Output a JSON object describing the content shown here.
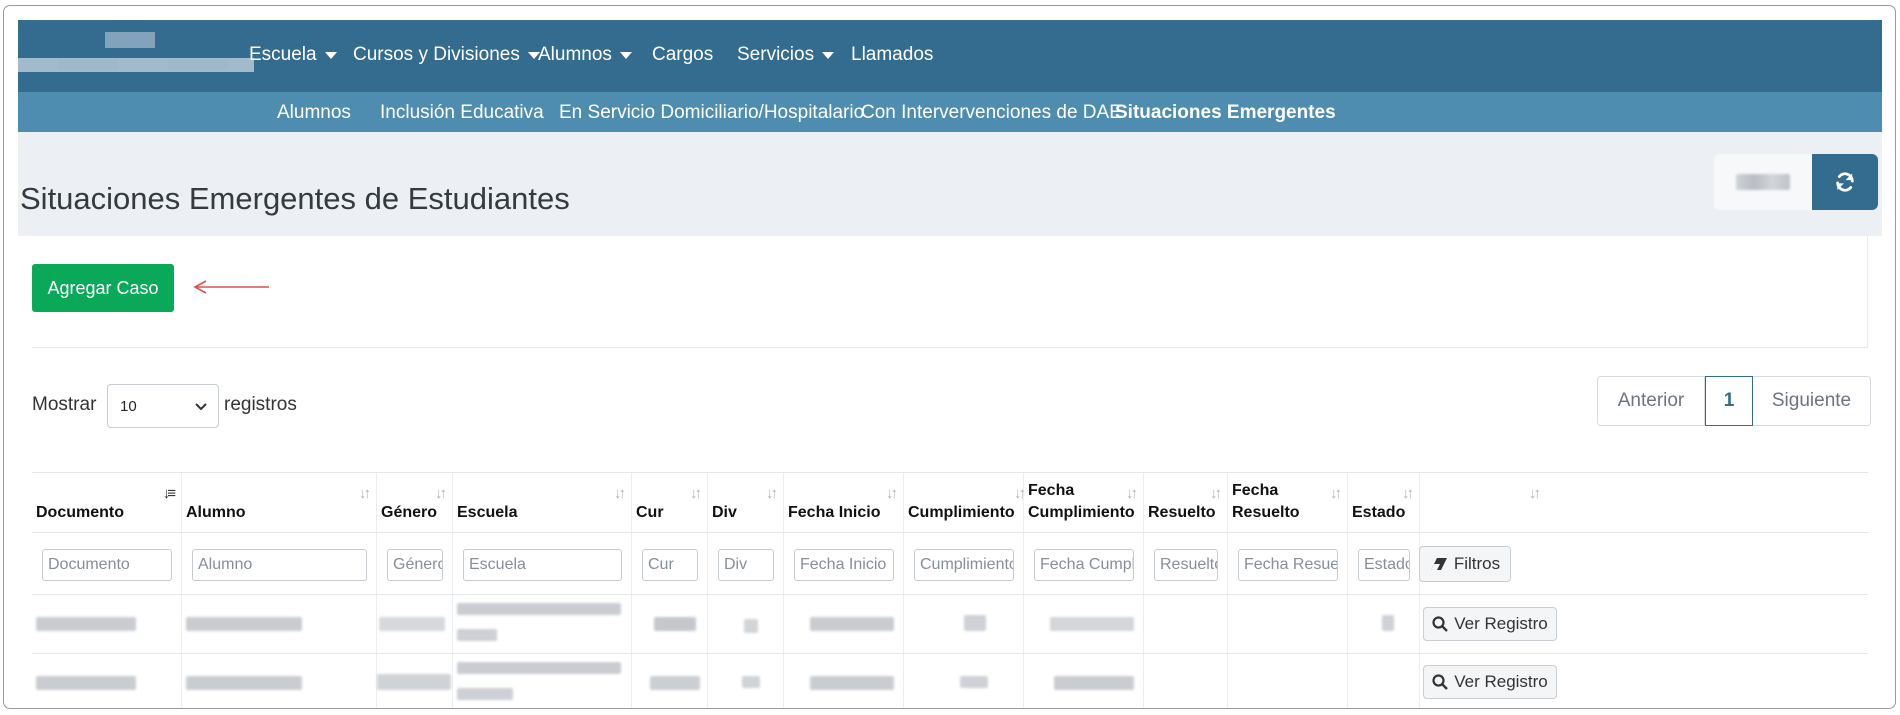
{
  "nav": {
    "items": [
      {
        "label": "Escuela",
        "dropdown": true
      },
      {
        "label": "Cursos y Divisiones",
        "dropdown": true
      },
      {
        "label": "Alumnos",
        "dropdown": true
      },
      {
        "label": "Cargos",
        "dropdown": false
      },
      {
        "label": "Servicios",
        "dropdown": true
      },
      {
        "label": "Llamados",
        "dropdown": false
      }
    ]
  },
  "subnav": {
    "items": [
      {
        "label": "Alumnos",
        "active": false
      },
      {
        "label": "Inclusión Educativa",
        "active": false
      },
      {
        "label": "En Servicio Domiciliario/Hospitalario",
        "active": false
      },
      {
        "label": "Con Intervervenciones de DAE",
        "active": false
      },
      {
        "label": "Situaciones Emergentes",
        "active": true
      }
    ]
  },
  "page": {
    "title": "Situaciones Emergentes de Estudiantes",
    "refresh_icon": "refresh-icon"
  },
  "actions": {
    "add_case_label": "Agregar Caso"
  },
  "length": {
    "prefix": "Mostrar",
    "value": "10",
    "suffix": "registros"
  },
  "pagination": {
    "prev": "Anterior",
    "current": "1",
    "next": "Siguiente"
  },
  "table": {
    "columns": [
      {
        "label": "Documento",
        "placeholder": "Documento"
      },
      {
        "label": "Alumno",
        "placeholder": "Alumno"
      },
      {
        "label": "Género",
        "placeholder": "Género"
      },
      {
        "label": "Escuela",
        "placeholder": "Escuela"
      },
      {
        "label": "Cur",
        "placeholder": "Cur"
      },
      {
        "label": "Div",
        "placeholder": "Div"
      },
      {
        "label": "Fecha Inicio",
        "placeholder": "Fecha Inicio"
      },
      {
        "label": "Cumplimiento",
        "placeholder": "Cumplimiento"
      },
      {
        "label": "Fecha Cumplimiento",
        "placeholder": "Fecha Cumplir"
      },
      {
        "label": "Resuelto",
        "placeholder": "Resuelto"
      },
      {
        "label": "Fecha Resuelto",
        "placeholder": "Fecha Resuelto"
      },
      {
        "label": "Estado",
        "placeholder": "Estado"
      },
      {
        "label": "",
        "placeholder": ""
      }
    ],
    "filters_button": "Filtros",
    "row_action": "Ver Registro"
  }
}
